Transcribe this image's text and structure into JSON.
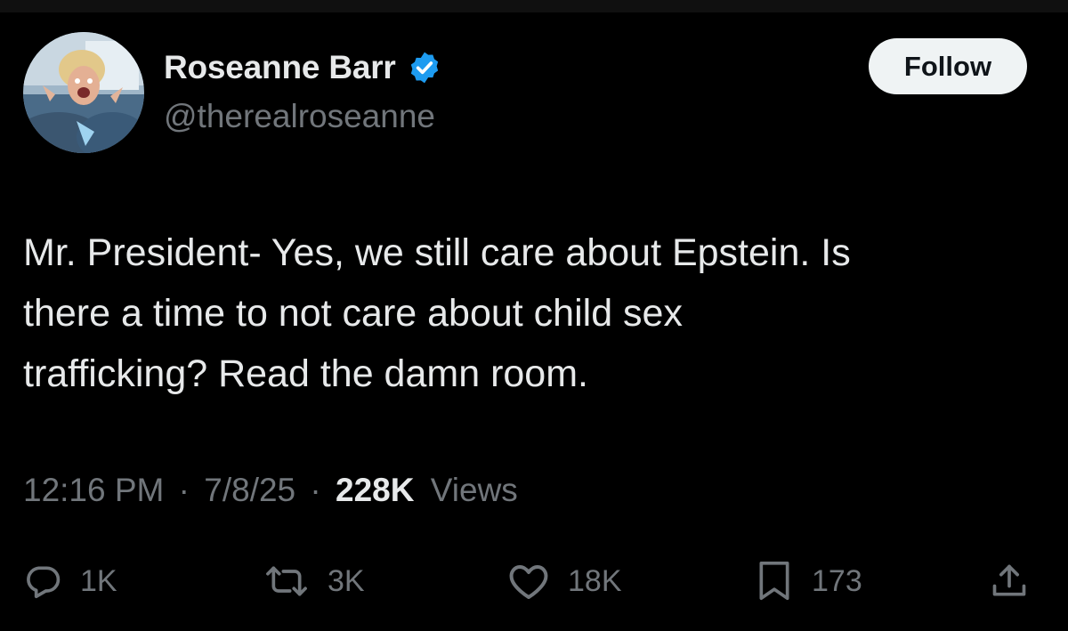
{
  "author": {
    "display_name": "Roseanne Barr",
    "handle": "@therealroseanne",
    "verified": true,
    "avatar_icon": "profile-photo",
    "verified_icon": "verified-badge-icon"
  },
  "follow_label": "Follow",
  "tweet": {
    "lines": [
      "Mr. President- Yes, we still care about Epstein. Is",
      "there a time to not care about child sex",
      "trafficking? Read the damn room."
    ]
  },
  "meta": {
    "time": "12:16 PM",
    "date": "7/8/25",
    "separator": "·",
    "views_count": "228K",
    "views_label": "Views"
  },
  "actions": {
    "reply": {
      "icon": "reply-icon",
      "count": "1K"
    },
    "repost": {
      "icon": "repost-icon",
      "count": "3K"
    },
    "like": {
      "icon": "heart-icon",
      "count": "18K"
    },
    "bookmark": {
      "icon": "bookmark-icon",
      "count": "173"
    },
    "share": {
      "icon": "share-icon"
    }
  },
  "colors": {
    "background": "#000000",
    "primary_text": "#e7e9ea",
    "secondary_text": "#71767b",
    "verified_blue": "#1d9bf0",
    "follow_button_bg": "#eff3f4",
    "follow_button_text": "#0f1419"
  }
}
